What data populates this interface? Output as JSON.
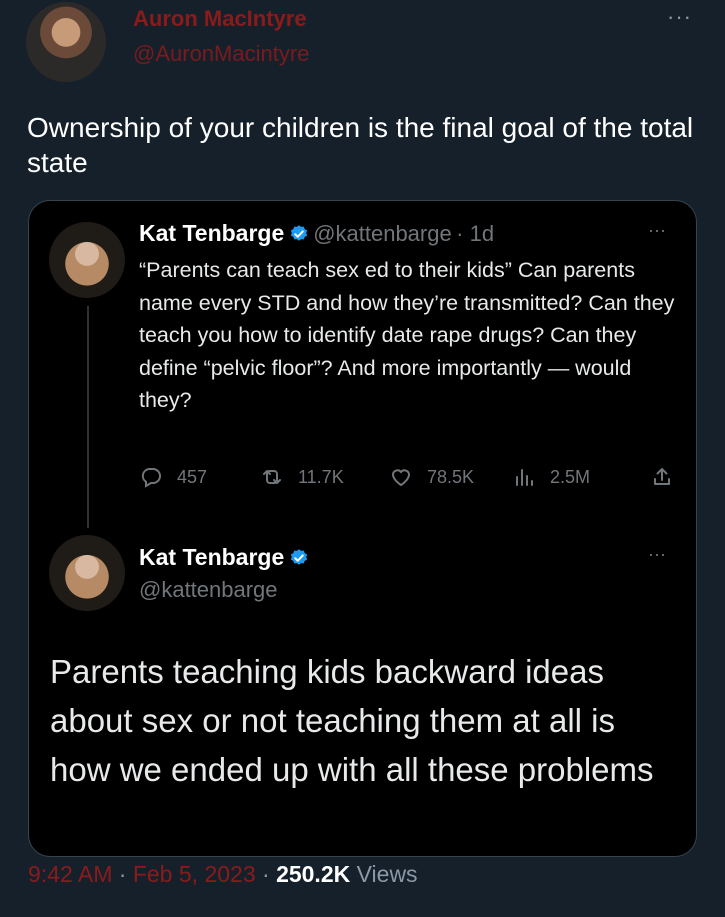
{
  "outer_tweet": {
    "display_name": "Auron MacIntyre",
    "handle": "@AuronMacintyre",
    "more": "···",
    "text": "Ownership of your children is the final goal of the total state"
  },
  "quoted_tweet_1": {
    "display_name": "Kat Tenbarge",
    "handle": "@kattenbarge",
    "age": "· 1d",
    "more": "···",
    "text": "“Parents can teach sex ed to their kids” Can parents name every STD and how they’re transmitted? Can they teach you how to identify date rape drugs? Can they define “pelvic floor”? And more importantly — would they?",
    "replies": "457",
    "retweets": "11.7K",
    "likes": "78.5K",
    "views": "2.5M"
  },
  "quoted_tweet_2": {
    "display_name": "Kat Tenbarge",
    "handle": "@kattenbarge",
    "more": "···",
    "text": "Parents teaching kids backward ideas about sex or not teaching them at all is how we ended up with all these problems"
  },
  "footer": {
    "time": "9:42 AM",
    "date": "Feb 5, 2023",
    "views_count": "250.2K",
    "views_label": "Views"
  },
  "colors": {
    "background": "#15202b",
    "card": "#000000",
    "name_accent": "#8b1b1b",
    "verified": "#1d9bf0"
  }
}
